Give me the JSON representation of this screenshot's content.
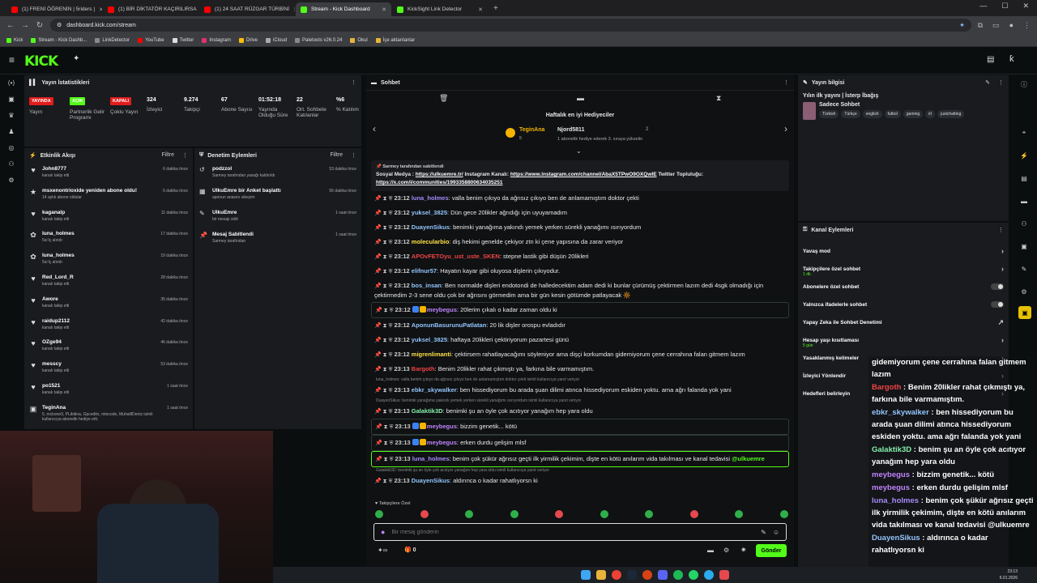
{
  "browser": {
    "tabs": [
      {
        "title": "(1) FRENİ ÖĞRENİN | 5riders |",
        "color": "#ff0000",
        "active": false
      },
      {
        "title": "(1) BİR DİKTATÖR KAÇIRILIRSA",
        "color": "#ff0000",
        "active": false
      },
      {
        "title": "(1) 24 SAAT RÜZGAR TÜRBİNİ",
        "color": "#ff0000",
        "active": false
      },
      {
        "title": "Stream - Kick Dashboard",
        "color": "#53fc18",
        "active": true
      },
      {
        "title": "KickSight Link Detector",
        "color": "#53fc18",
        "active": false
      }
    ],
    "url": "dashboard.kick.com/stream",
    "bookmarks": [
      "Kick",
      "Stream - Kick Dashb...",
      "LinkDetector",
      "YouTube",
      "Twitter",
      "Instagram",
      "Drive",
      "iCloud",
      "Paletools v26.0.24",
      "Okul",
      "İçe aktarılanlar"
    ]
  },
  "stats": {
    "title": "Yayın İstatistikleri",
    "items": [
      {
        "badge": "YAYINDA",
        "badge_color": "#e11d1d",
        "label": "Yayın"
      },
      {
        "badge": "AÇIK",
        "badge_color": "#53fc18",
        "label": "Partnerlik Gelir Programı"
      },
      {
        "badge": "KAPALI",
        "badge_color": "#e11d1d",
        "label": "Çoklu Yayın"
      },
      {
        "value": "324",
        "label": "İzleyici"
      },
      {
        "value": "9.274",
        "label": "Takipçi"
      },
      {
        "value": "67",
        "label": "Abone Sayısı"
      },
      {
        "value": "01:52:18",
        "label": "Yayında Olduğu Süre"
      },
      {
        "value": "22",
        "label": "Ort. Sohbete Katılanlar"
      },
      {
        "value": "%6",
        "label": "% Katılım"
      }
    ]
  },
  "activity": {
    "title": "Etkinlik Akışı",
    "filter": "Filtre",
    "rows": [
      {
        "name": "John8777",
        "sub": "kanalı takip etti",
        "time": "6 dakika önce",
        "icon": "♥"
      },
      {
        "name": "msxenontrioxide yeniden abone oldu!",
        "sub": "14 aylık abone oldular",
        "time": "6 dakika önce",
        "icon": "★"
      },
      {
        "name": "kaganalp",
        "sub": "kanalı takip etti",
        "time": "11 dakika önce",
        "icon": "♥"
      },
      {
        "name": "luna_holmes",
        "sub": "5sı'iç alındı",
        "time": "17 dakika önce",
        "icon": "✿"
      },
      {
        "name": "luna_holmes",
        "sub": "5sı'iç alındı",
        "time": "19 dakika önce",
        "icon": "✿"
      },
      {
        "name": "Red_Lord_R",
        "sub": "kanalı takip etti",
        "time": "28 dakika önce",
        "icon": "♥"
      },
      {
        "name": "Awore",
        "sub": "kanalı takip etti",
        "time": "35 dakika önce",
        "icon": "♥"
      },
      {
        "name": "raidup2112",
        "sub": "kanalı takip etti",
        "time": "42 dakika önce",
        "icon": "♥"
      },
      {
        "name": "OZge94",
        "sub": "kanalı takip etti",
        "time": "46 dakika önce",
        "icon": "♥"
      },
      {
        "name": "messcy",
        "sub": "kanalı takip etti",
        "time": "53 dakika önce",
        "icon": "♥"
      },
      {
        "name": "po1521",
        "sub": "kanalı takip etti",
        "time": "1 saat önce",
        "icon": "♥"
      },
      {
        "name": "TeginAna",
        "sub": "5, mckone9, PLibitina, Gpcedits, mtecode, MuhalifDeniz isimli kullanıcıya abonelik hediye etti.",
        "time": "1 saat önce",
        "icon": "▣"
      }
    ]
  },
  "moderation": {
    "title": "Denetim Eylemleri",
    "filter": "Filtre",
    "rows": [
      {
        "name": "podzzol",
        "sub": "Sarmey tarafından yasağı kaldırıldı",
        "time": "53 dakika önce",
        "icon": "↺"
      },
      {
        "name": "UlkuEmre bir Anket başlattı",
        "sub": "aponun anasını sikeyim",
        "time": "56 dakika önce",
        "icon": "▦"
      },
      {
        "name": "UlkuEmre",
        "sub": "bir mesajı sildi",
        "time": "1 saat önce",
        "icon": "✎"
      },
      {
        "name": "Mesaj Sabitlendi",
        "sub": "Sarmey tarafından",
        "time": "1 saat önce",
        "icon": "📌"
      }
    ]
  },
  "chat": {
    "title": "Sohbet",
    "gifts_title": "Haftalık en iyi Hediyeciler",
    "gifter1": {
      "name": "TeginAna",
      "count": "5"
    },
    "gifter2": {
      "name": "Njord5811",
      "count": "2",
      "note": "1 abonelik hediye ederek 3. sıraya yükselin"
    },
    "pinned": {
      "by": "Sarmey tarafından sabitlendi",
      "text1": "Sosyal Medya : ",
      "link1": "https://ulkuemre.tr/",
      "text2": " Instagram Kanalı: ",
      "link2": "https://www.instagram.com/channel/AbaX5TPwO9OXQwIE",
      "text3": " Twitter Topluluğu: ",
      "link3": "https://x.com/i/communities/1993358800634035251"
    },
    "messages": [
      {
        "time": "23:12",
        "name": "luna_holmes",
        "color": "#a78bfa",
        "text": "valla benim çıkıyo da ağrısız çıkıyo ben de anlamamıştım doktor çekti"
      },
      {
        "time": "23:12",
        "name": "yuksel_3825",
        "color": "#93c5fd",
        "text": "Dün gece 20likler ağrıdığı için uyuyamadım"
      },
      {
        "time": "23:12",
        "name": "DuayenSikus",
        "color": "#93c5fd",
        "text": "benimki yanağıma yakındı yemek yerken sürekli yanağımı ısırıyordum"
      },
      {
        "time": "23:12",
        "name": "molecularbio",
        "color": "#fde047",
        "text": "diş hekimi genelde çekiyor ztn ki çene yapısına da zarar veriyor"
      },
      {
        "time": "23:12",
        "name": "APOvFETOyu_ust_uste_SKEN",
        "color": "#ef4444",
        "text": "stepne lastik gibi düşün 20likleri"
      },
      {
        "time": "23:12",
        "name": "elifnur57",
        "color": "#93c5fd",
        "text": "Hayatın kayar gibi oluyosa dişlerin çıkıyodur."
      },
      {
        "time": "23:12",
        "name": "bos_insan",
        "color": "#93c5fd",
        "text": "Ben normalde dişleri endotondi de halledecektim adam dedi ki bunlar çürümüş çektirmen lazım dedi 4sgk olmadığı için çektirmedim 2-3 sene oldu çok bir ağrısını görmedim ama bir gün kesin götümde patlayacak 🔆"
      },
      {
        "time": "23:12",
        "name": "meybegus",
        "color": "#c084fc",
        "text": "20lerim çıkalı o kadar zaman oldu ki",
        "hl": true
      },
      {
        "time": "23:12",
        "name": "AponunBasurunuPatlatan",
        "color": "#93c5fd",
        "text": "20 lik dişler orospu evladıdır"
      },
      {
        "time": "23:12",
        "name": "yuksel_3825",
        "color": "#93c5fd",
        "text": "haftaya 20likleri çektiriyorum pazartesi günü"
      },
      {
        "time": "23:12",
        "name": "migrenlimanti",
        "color": "#fde047",
        "text": "çektirsem rahatlayacağımı söyleniyor ama dişçi korkumdan gidemiyorum çene cerrahına falan gitmem lazım"
      },
      {
        "time": "23:13",
        "name": "Bargoth",
        "color": "#ef4444",
        "text": "Benim 20likler rahat çıkmıştı ya, farkına bile varmamıştım."
      },
      {
        "reply": "luna_holmes: valla benim çıkıyo da ağrısız çıkıyo ben de anlamamıştım doktor çekti isimli kullanıcıya yanıt veriyor",
        "time": "23:13",
        "name": "ebkr_skywalker",
        "color": "#93c5fd",
        "text": "ben hissediyorum bu arada şuan dilimi atınca hissediyorum eskiden yoktu. ama ağrı falanda yok yani"
      },
      {
        "reply": "DuayenSikus: benimki yanağıma yakındı yemek yerken sürekli yanağımı ısırıyordum isimli kullanıcıya yanıt veriyor",
        "time": "23:13",
        "name": "Galaktik3D",
        "color": "#86efac",
        "text": "benimki şu an öyle çok acıtıyor yanağım hep yara oldu"
      },
      {
        "time": "23:13",
        "name": "meybegus",
        "color": "#c084fc",
        "text": "bizzim genetik... kötü",
        "hl": true
      },
      {
        "time": "23:13",
        "name": "meybegus",
        "color": "#c084fc",
        "text": "erken durdu gelişim mlsf",
        "hl": true
      },
      {
        "time": "23:13",
        "name": "luna_holmes",
        "color": "#a78bfa",
        "text": "benim çok şükür ağrısız geçti ilk yirmilik çekimim, dişte en kötü anılarım vida takılması ve kanal tedavisi",
        "mention": "@ulkuemre",
        "hl2": true
      },
      {
        "reply": "Galaktik3D: benimki şu an öyle çok acıtıyor yanağım hep yara oldu isimli kullanıcıya yanıt veriyor",
        "time": "23:13",
        "name": "DuayenSikus",
        "color": "#93c5fd",
        "text": "aldırınca o kadar rahatlıyorsn ki"
      }
    ],
    "follower_note": "Takipçilere Özel",
    "input_placeholder": "Bir mesaj gönderin",
    "points": "0",
    "send": "Gönder"
  },
  "streaminfo": {
    "title": "Yayın bilgisi",
    "stream_title": "Yılın ilk yayını | İsterp İbağış",
    "category": "Sadece Sohbet",
    "tags": [
      "Türkish",
      "Türkçe",
      "english",
      "futbol",
      "gaming",
      "irl",
      "justchatting"
    ]
  },
  "channel_actions": {
    "title": "Kanal Eylemleri",
    "rows": [
      {
        "label": "Yavaş mod",
        "ctl": "›"
      },
      {
        "label": "Takipçilere özel sohbet",
        "sub": "1 dk.",
        "ctl": "›"
      },
      {
        "label": "Abonelere özel sohbet",
        "ctl": "toggle"
      },
      {
        "label": "Yalnızca ifadelerle sohbet",
        "ctl": "toggle"
      },
      {
        "label": "Yapay Zeka ile Sohbet Denetimi",
        "ctl": "↗"
      },
      {
        "label": "Hesap yaşı kısıtlaması",
        "sub": "5 gün",
        "ctl": "›"
      },
      {
        "label": "Yasaklanmış kelimeler",
        "ctl": "›"
      },
      {
        "label": "İzleyici Yönlendir",
        "ctl": "›"
      },
      {
        "label": "Hedefleri belirleyin",
        "ctl": "›"
      }
    ]
  },
  "overlay": {
    "lines": [
      {
        "name": "",
        "color": "#fff",
        "text": "gidemiyorum çene cerrahına falan gitmem lazım"
      },
      {
        "name": "Bargoth",
        "color": "#ef4444",
        "text": "Benim 20likler rahat çıkmıştı ya, farkına bile varmamıştım."
      },
      {
        "name": "ebkr_skywalker",
        "color": "#93c5fd",
        "text": "ben hissediyorum bu arada şuan dilimi atınca hissediyorum eskiden yoktu. ama ağrı falanda yok yani"
      },
      {
        "name": "Galaktik3D",
        "color": "#86efac",
        "text": "benim şu an öyle çok acıtıyor yanağım hep yara oldu"
      },
      {
        "name": "meybegus",
        "color": "#c084fc",
        "text": "bizzim genetik... kötü"
      },
      {
        "name": "meybegus",
        "color": "#c084fc",
        "text": "erken durdu gelişim mlsf"
      },
      {
        "name": "luna_holmes",
        "color": "#a78bfa",
        "text": "benim çok şükür ağrısız geçti ilk yirmilik çekimim, dişte en kötü anılarım vida takılması ve kanal tedavisi @ulkuemre"
      },
      {
        "name": "DuayenSikus",
        "color": "#93c5fd",
        "text": "aldırınca o kadar rahatlıyorsn ki"
      }
    ]
  },
  "clock": {
    "time": "23:13",
    "date": "6.01.2026"
  }
}
